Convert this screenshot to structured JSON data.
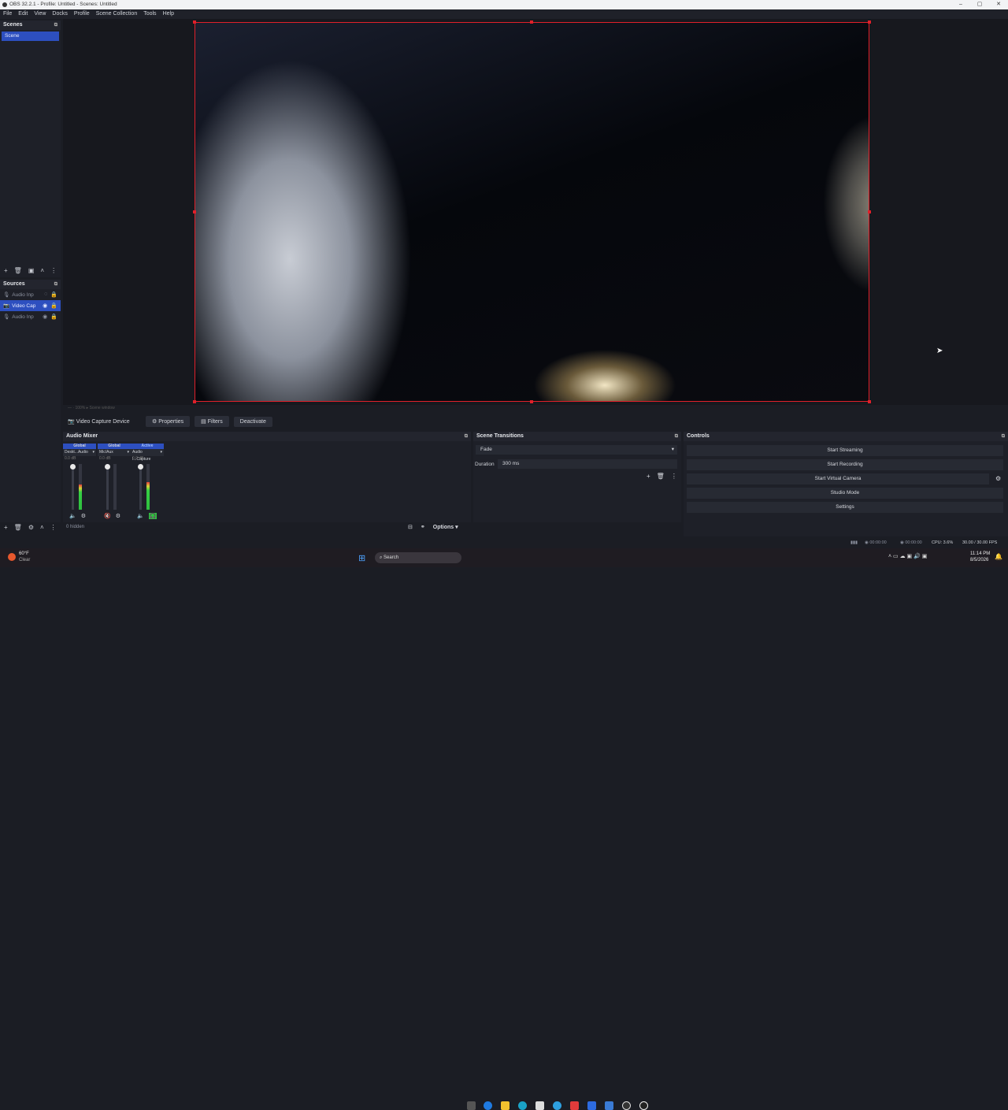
{
  "window": {
    "title": "OBS 32.2.1 - Profile: Untitled - Scenes: Untitled",
    "min": "–",
    "max": "▢",
    "close": "✕"
  },
  "menu": [
    "File",
    "Edit",
    "View",
    "Docks",
    "Profile",
    "Scene Collection",
    "Tools",
    "Help"
  ],
  "scenes": {
    "title": "Scenes",
    "items": [
      "Scene"
    ]
  },
  "sources": {
    "title": "Sources",
    "items": [
      {
        "label": "Audio Inp",
        "selected": false
      },
      {
        "label": "Video Cap",
        "selected": true
      },
      {
        "label": "Audio Inp",
        "selected": false
      }
    ]
  },
  "preview_strip": "— · 100%     ▸  Scene window",
  "source_toolbar": {
    "name": "Video Capture Device",
    "properties": "Properties",
    "filters": "Filters",
    "deactivate": "Deactivate"
  },
  "mixer": {
    "title": "Audio Mixer",
    "hidden": "0 hidden",
    "options": "Options",
    "channels": [
      {
        "scope": "Global",
        "name": "Deskt...Audio",
        "db": "0.0 dB",
        "level": 0.55
      },
      {
        "scope": "Global",
        "name": "Mic/Aux",
        "db": "0.0 dB",
        "level": 0.0
      },
      {
        "scope": "Active",
        "name": "Audio I...Capture",
        "db": "0.0 dB",
        "level": 0.6
      }
    ]
  },
  "transitions": {
    "title": "Scene Transitions",
    "type": "Fade",
    "duration_label": "Duration",
    "duration": "300 ms"
  },
  "controls": {
    "title": "Controls",
    "buttons": [
      "Start Streaming",
      "Start Recording",
      "Start Virtual Camera",
      "Studio Mode",
      "Settings"
    ]
  },
  "status": {
    "stream_time": "00:00:00",
    "rec_time": "00:00:00",
    "cpu": "CPU: 3.6%",
    "fps": "30.00 / 30.00 FPS"
  },
  "taskbar": {
    "weather_temp": "60°F",
    "weather_desc": "Clear",
    "search": "Search",
    "time": "11:14 PM",
    "date": "8/5/2026"
  },
  "colors": {
    "accent": "#2d4fbf",
    "preview_border": "#e0202a"
  }
}
